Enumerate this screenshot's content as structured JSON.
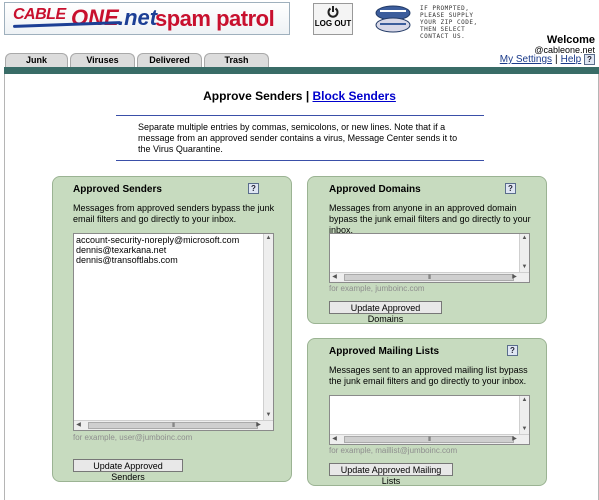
{
  "header": {
    "logo_cable": "CABLE",
    "logo_one": "ONE",
    "logo_net": ".net",
    "logo_spam": "spam patrol",
    "logout_label": "LOG OUT",
    "contact_text": "IF PROMPTED, PLEASE SUPPLY YOUR ZIP CODE, THEN SELECT CONTACT US.",
    "welcome": "Welcome",
    "email": "@cableone.net"
  },
  "tabs": [
    {
      "label": "Junk"
    },
    {
      "label": "Viruses"
    },
    {
      "label": "Delivered"
    },
    {
      "label": "Trash"
    }
  ],
  "top_links": {
    "settings": "My Settings",
    "separator": "|",
    "help": "Help",
    "help_icon": "?"
  },
  "title": {
    "main": "Approve Senders",
    "separator": "|",
    "link": "Block Senders"
  },
  "instructions": "Separate multiple entries by commas, semicolons, or new lines. Note that if a message from an approved sender contains a virus, Message Center sends it to the Virus Quarantine.",
  "panels": {
    "senders": {
      "title": "Approved Senders",
      "help": "?",
      "description": "Messages from approved senders bypass the junk email filters and go directly to your inbox.",
      "entries": [
        "account-security-noreply@microsoft.com",
        "dennis@texarkana.net",
        "dennis@transoftlabs.com"
      ],
      "example": "for example, user@jumboinc.com",
      "button": "Update Approved Senders"
    },
    "domains": {
      "title": "Approved Domains",
      "help": "?",
      "description": "Messages from anyone in an approved domain bypass the junk email filters and go directly to your inbox.",
      "example": "for example, jumboinc.com",
      "button": "Update Approved Domains"
    },
    "mailing_lists": {
      "title": "Approved Mailing Lists",
      "help": "?",
      "description": "Messages sent to an approved mailing list bypass the junk email filters and go directly to your inbox.",
      "example": "for example, maillist@jumboinc.com",
      "button": "Update Approved Mailing Lists"
    }
  },
  "scroll_grip": "III",
  "colors": {
    "brand_red": "#c8102e",
    "brand_blue": "#1c3f95",
    "teal_bar": "#396c67",
    "panel_bg": "#c7dbbf",
    "link": "#0000cc"
  }
}
